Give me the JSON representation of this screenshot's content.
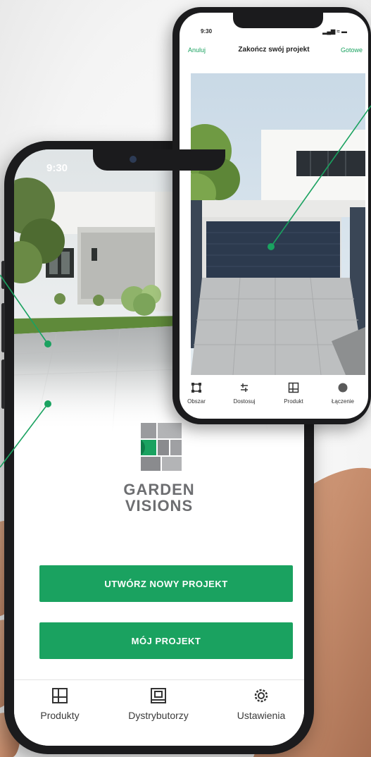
{
  "main_phone": {
    "status_time": "9:30",
    "brand": {
      "line1": "GARDEN",
      "line2": "VISIONS"
    },
    "buttons": {
      "new_project": "UTWÓRZ NOWY PROJEKT",
      "my_project": "MÓJ PROJEKT"
    },
    "tabs": [
      {
        "label": "Produkty",
        "icon": "products-icon"
      },
      {
        "label": "Dystrybutorzy",
        "icon": "distributors-icon"
      },
      {
        "label": "Ustawienia",
        "icon": "settings-icon"
      }
    ]
  },
  "second_phone": {
    "status_time": "9:30",
    "status_icons": "▂▄▆ ≈ ▬",
    "nav": {
      "cancel": "Anuluj",
      "title": "Zakończ swój projekt",
      "done": "Gotowe"
    },
    "tools": [
      {
        "label": "Obszar",
        "icon": "area-icon"
      },
      {
        "label": "Dostosuj",
        "icon": "adjust-icon"
      },
      {
        "label": "Produkt",
        "icon": "product-icon"
      },
      {
        "label": "Łączenie",
        "icon": "joining-icon"
      }
    ]
  },
  "colors": {
    "accent_green": "#1aa260",
    "brand_gray": "#6d6e71",
    "phone_frame": "#1b1b1d"
  }
}
